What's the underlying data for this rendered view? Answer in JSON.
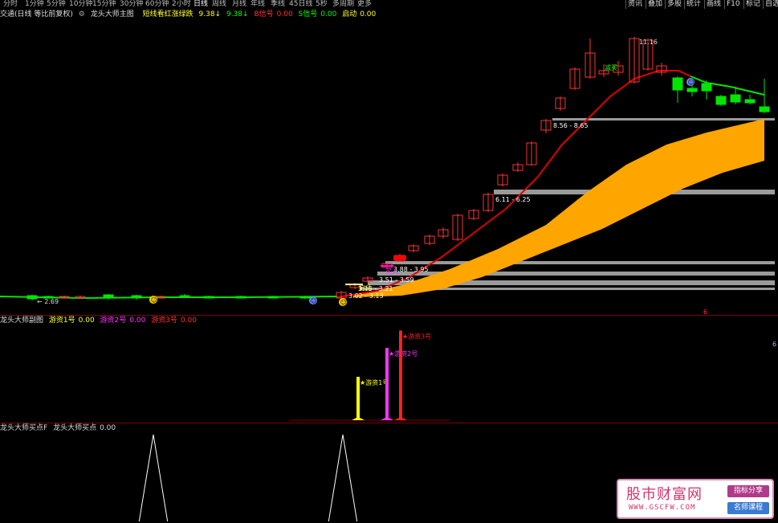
{
  "toolbar": {
    "periods": [
      "分时",
      "1分钟",
      "5分钟",
      "10分钟",
      "15分钟",
      "30分钟",
      "60分钟",
      "2小时",
      "日线",
      "周线",
      "月线",
      "年线",
      "季线",
      "45日线",
      "5秒",
      "多周期",
      "更多"
    ],
    "right_buttons": [
      "资讯",
      "叠加",
      "多股",
      "统计",
      "画线",
      "F10",
      "标记",
      "自选"
    ]
  },
  "main_info": {
    "title": "交通(日线 等比前复权)",
    "indicator": "龙头大师主图",
    "label1": "短线看红涨绿跌",
    "val1": "9.38↓",
    "val2": "9.38↓",
    "b_label": "B信号",
    "b_val": "0.00",
    "s_label": "S信号",
    "s_val": "0.00",
    "start_label": "启动",
    "start_val": "0.00"
  },
  "main_chart": {
    "annotations": {
      "high": "11.16",
      "low": "2.69",
      "jian": "减买",
      "range1": "8.56 - 8.65",
      "range2": "6.11 - 6.25",
      "range3": "3.88 - 3.95",
      "range4": "3.51 - 3.59",
      "range5": "3.15 - 3.21",
      "range6": "3.02 - 3.13",
      "buy1": "买入",
      "buy2": "启动",
      "mark": "6"
    },
    "colors": {
      "up": "#ff3232",
      "down": "#00e600",
      "ma": "#e00000",
      "ma_down": "#00e600",
      "band": "#ffa500",
      "zone": "#9a9a9a"
    }
  },
  "sub_info": {
    "title": "龙头大师副图",
    "s1_label": "游资1号",
    "s1_val": "0.00",
    "s2_label": "游资2号",
    "s2_val": "0.00",
    "s3_label": "游资3号",
    "s3_val": "0.00"
  },
  "sub_chart": {
    "bars": [
      {
        "label": "★游资1号",
        "color": "#ffff00",
        "value": 0.45
      },
      {
        "label": "★游资2号",
        "color": "#ff33ff",
        "value": 0.75
      },
      {
        "label": "★游资3号",
        "color": "#ff2020",
        "value": 0.93
      }
    ],
    "right_tick": "6"
  },
  "low_info": {
    "title": "龙头大师买点F",
    "label": "龙头大师买点",
    "val": "0.00"
  },
  "watermark": {
    "logo": "股市财富网",
    "url": "WWW.GSCFW.COM",
    "tag1": "指标分享",
    "tag2": "名师课程"
  }
}
